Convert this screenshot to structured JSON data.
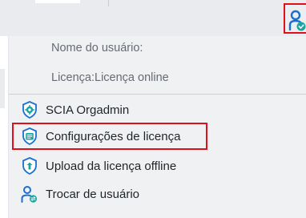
{
  "user_menu": {
    "username_label": "Nome do usuário:",
    "license_label": "Licença:Licença online",
    "items": [
      {
        "label": "SCIA Orgadmin",
        "icon": "scia-orgadmin-icon"
      },
      {
        "label": "Configurações de licença",
        "icon": "license-settings-icon",
        "highlighted": true
      },
      {
        "label": "Upload da licença offline",
        "icon": "upload-license-icon"
      },
      {
        "label": "Trocar de usuário",
        "icon": "switch-user-icon"
      }
    ]
  },
  "colors": {
    "accent": "#1a6fd0",
    "highlight_border": "#e0101a",
    "status_check": "#19a6a0",
    "menu_bg": "#f0f1f3"
  }
}
